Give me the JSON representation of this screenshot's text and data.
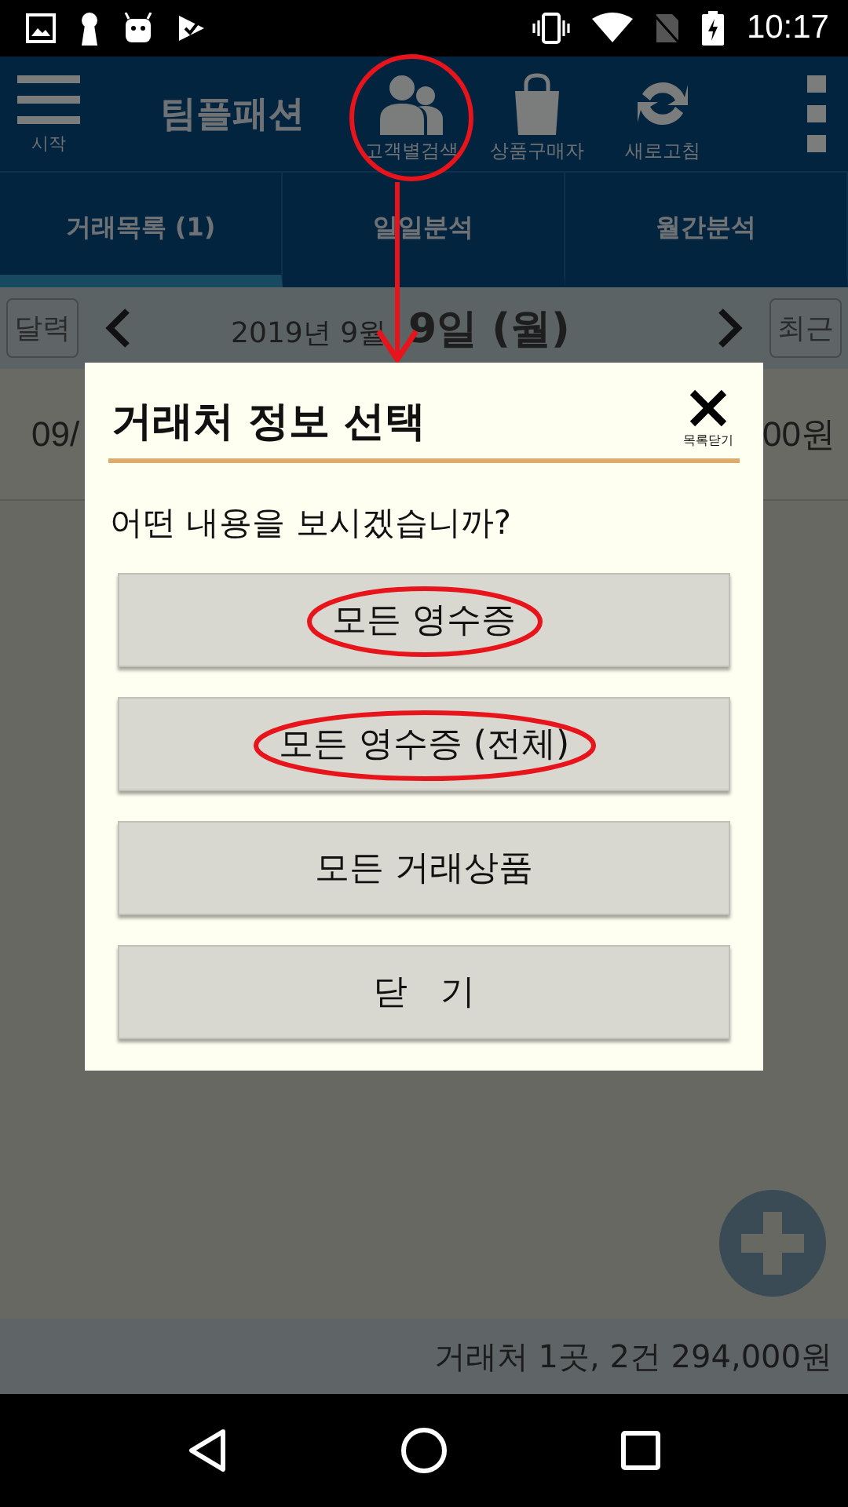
{
  "status_bar": {
    "time": "10:17"
  },
  "app_bar": {
    "menu_label": "시작",
    "title": "팀플패션",
    "actions": [
      {
        "kind": "people",
        "label": "고객별검색",
        "highlighted": true
      },
      {
        "kind": "bag",
        "label": "상품구매자",
        "highlighted": false
      },
      {
        "kind": "refresh",
        "label": "새로고침",
        "highlighted": false
      }
    ]
  },
  "tabs": [
    {
      "label": "거래목록 (1)",
      "selected": true
    },
    {
      "label": "일일분석",
      "selected": false
    },
    {
      "label": "월간분석",
      "selected": false
    }
  ],
  "date_bar": {
    "left_button": "달력",
    "month": "2019년 9월",
    "day": "9일 (월)",
    "right_button": "최근"
  },
  "row": {
    "date": "09/",
    "amount": "00원"
  },
  "footer": "거래처 1곳,  2건 294,000원",
  "dialog": {
    "title": "거래처 정보 선택",
    "close_label": "목록닫기",
    "question": "어떤 내용을 보시겠습니까?",
    "buttons": [
      {
        "label": "모든 영수증",
        "highlighted": true
      },
      {
        "label": "모든 영수증 (전체)",
        "highlighted": true
      },
      {
        "label": "모든 거래상품",
        "highlighted": false
      },
      {
        "label": "닫   기",
        "highlighted": false
      }
    ]
  }
}
